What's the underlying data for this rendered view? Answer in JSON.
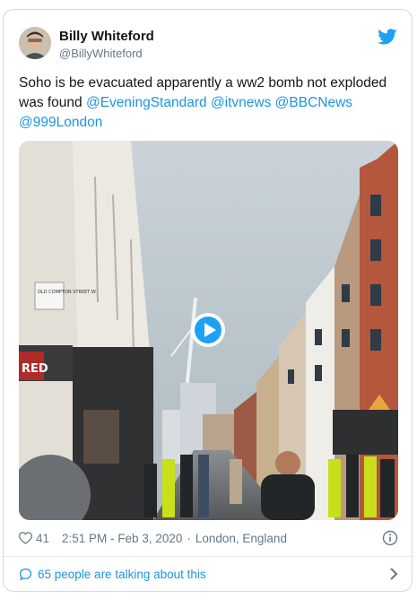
{
  "author": {
    "name": "Billy Whiteford",
    "handle": "@BillyWhiteford"
  },
  "tweet": {
    "text_plain": "Soho is be evacuated apparently a ww2 bomb not exploded was found ",
    "mentions": [
      "@EveningStandard",
      "@itvnews",
      "@BBCNews",
      "@999London"
    ]
  },
  "media": {
    "street_sign": "OLD COMPTON STREET W1",
    "shop_sign": "RED"
  },
  "meta": {
    "likes": "41",
    "time": "2:51 PM - Feb 3, 2020",
    "separator": "·",
    "location": "London, England"
  },
  "conversation": {
    "label": "65 people are talking about this"
  },
  "icons": {
    "brand": "twitter-bird-icon",
    "like": "heart-icon",
    "info": "info-icon",
    "conversation": "speech-bubble-icon",
    "more": "chevron-right-icon",
    "play": "play-icon"
  },
  "colors": {
    "link": "#1b95e0",
    "brand": "#1da1f2",
    "secondary_text": "#657786",
    "border": "#cfd9de"
  }
}
